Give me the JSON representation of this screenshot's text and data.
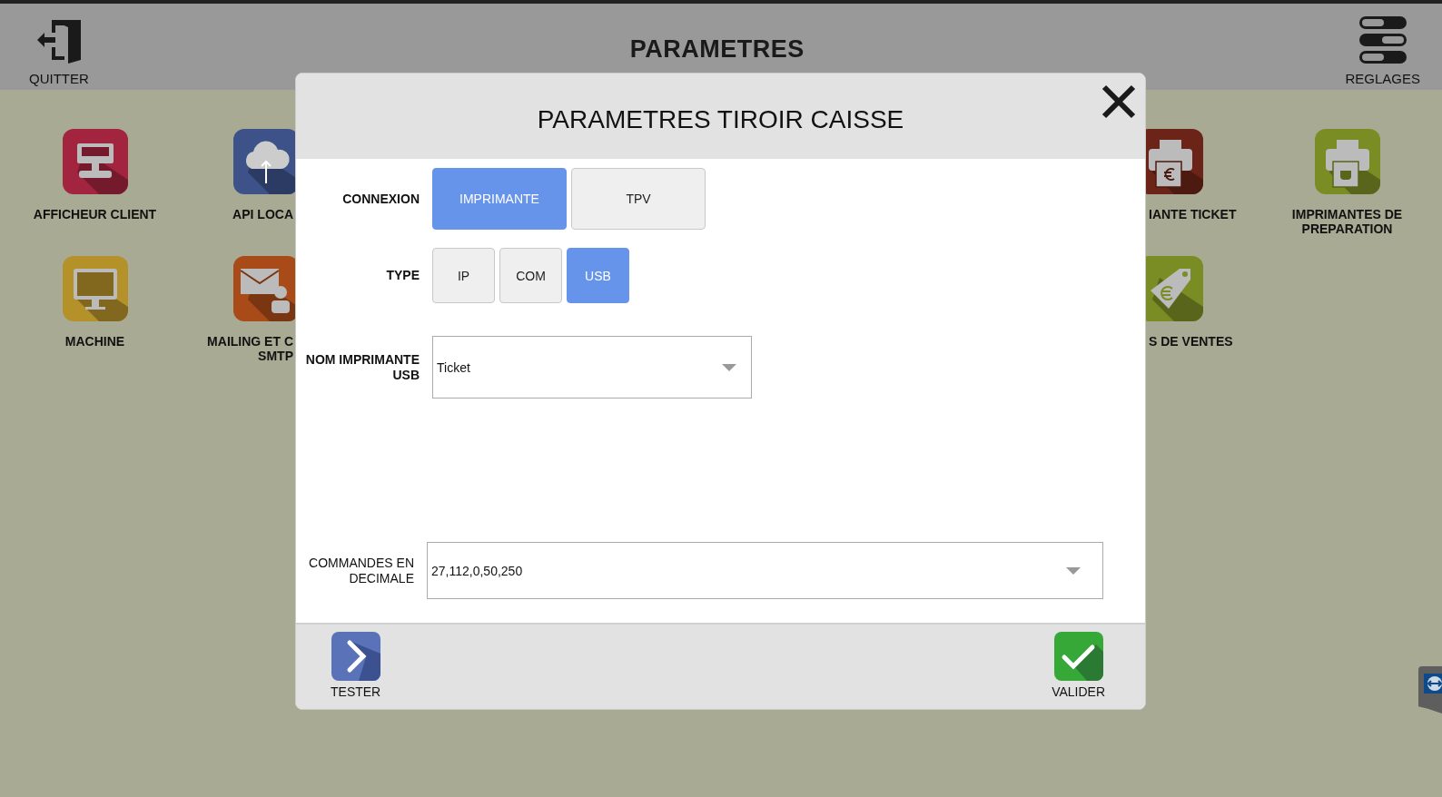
{
  "header": {
    "quit_label": "QUITTER",
    "title": "PARAMETRES",
    "settings_label": "REGLAGES"
  },
  "tile_rows": [
    {
      "left": [
        {
          "label": "AFFICHEUR CLIENT",
          "color": "#a3243f"
        },
        {
          "label": "API LOCA",
          "color": "#3d5289"
        }
      ],
      "right": [
        {
          "label": "IANTE TICKET",
          "color": "#6b2417"
        },
        {
          "label": "IMPRIMANTES DE PREPARATION",
          "color": "#7a8c24"
        }
      ]
    },
    {
      "left": [
        {
          "label": "MACHINE",
          "color": "#b5912a"
        },
        {
          "label": "MAILING ET C\nSMTP",
          "color": "#a84b18"
        }
      ],
      "right": [
        {
          "label": "S DE VENTES",
          "color": "#7a8c24"
        }
      ]
    }
  ],
  "dialog": {
    "title": "PARAMETRES TIROIR CAISSE",
    "fields": [
      {
        "kind": "choice",
        "label": "CONNEXION",
        "options": [
          {
            "label": "IMPRIMANTE",
            "selected": true
          },
          {
            "label": "TPV",
            "selected": false
          }
        ]
      },
      {
        "kind": "choice",
        "label": "TYPE",
        "options": [
          {
            "label": "IP",
            "selected": false
          },
          {
            "label": "COM",
            "selected": false
          },
          {
            "label": "USB",
            "selected": true
          }
        ]
      },
      {
        "kind": "select",
        "label": "NOM IMPRIMANTE USB",
        "value": "Ticket"
      },
      {
        "kind": "wide-select",
        "label": "COMMANDES EN DECIMALE",
        "value": "27,112,0,50,250"
      }
    ],
    "actions": [
      {
        "kind": "test",
        "label": "TESTER"
      },
      {
        "kind": "confirm",
        "label": "VALIDER"
      }
    ]
  }
}
